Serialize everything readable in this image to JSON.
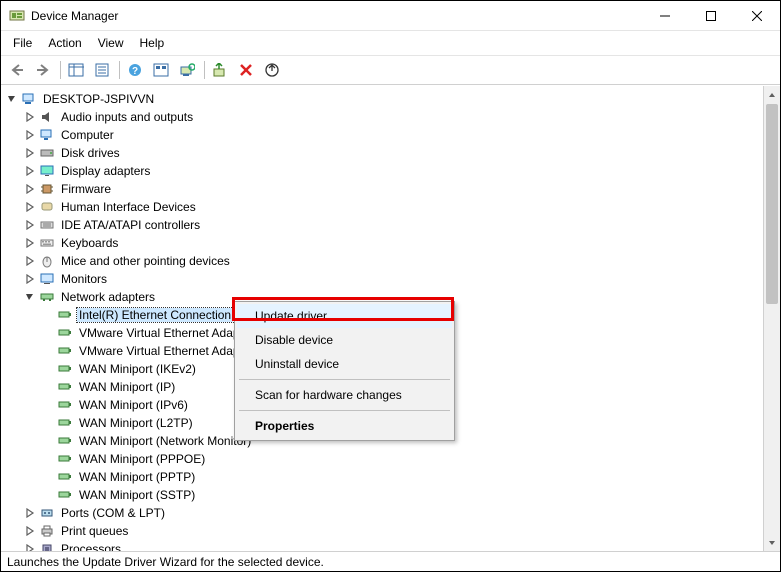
{
  "window": {
    "title": "Device Manager"
  },
  "menu": {
    "file": "File",
    "action": "Action",
    "view": "View",
    "help": "Help"
  },
  "toolbar": {
    "back": "Back",
    "forward": "Forward",
    "show_hide_tree": "Show/Hide Console Tree",
    "properties": "Properties",
    "help": "Help",
    "show_hidden": "Show hidden devices",
    "scan": "Scan for hardware changes",
    "update_driver": "Update device driver",
    "uninstall": "Uninstall device",
    "add_legacy": "Add legacy hardware"
  },
  "root": {
    "label": "DESKTOP-JSPIVVN"
  },
  "categories": [
    {
      "label": "Audio inputs and outputs",
      "icon": "speaker"
    },
    {
      "label": "Computer",
      "icon": "computer"
    },
    {
      "label": "Disk drives",
      "icon": "disk"
    },
    {
      "label": "Display adapters",
      "icon": "display"
    },
    {
      "label": "Firmware",
      "icon": "chip"
    },
    {
      "label": "Human Interface Devices",
      "icon": "hid"
    },
    {
      "label": "IDE ATA/ATAPI controllers",
      "icon": "ide"
    },
    {
      "label": "Keyboards",
      "icon": "keyboard"
    },
    {
      "label": "Mice and other pointing devices",
      "icon": "mouse"
    },
    {
      "label": "Monitors",
      "icon": "monitor"
    }
  ],
  "network": {
    "label": "Network adapters",
    "items": [
      "Intel(R) Ethernet Connection",
      "VMware Virtual Ethernet Adapter",
      "VMware Virtual Ethernet Adapter",
      "WAN Miniport (IKEv2)",
      "WAN Miniport (IP)",
      "WAN Miniport (IPv6)",
      "WAN Miniport (L2TP)",
      "WAN Miniport (Network Monitor)",
      "WAN Miniport (PPPOE)",
      "WAN Miniport (PPTP)",
      "WAN Miniport (SSTP)"
    ]
  },
  "tail_categories": [
    {
      "label": "Ports (COM & LPT)",
      "icon": "port"
    },
    {
      "label": "Print queues",
      "icon": "printer"
    },
    {
      "label": "Processors",
      "icon": "cpu"
    }
  ],
  "context_menu": {
    "update": "Update driver",
    "disable": "Disable device",
    "uninstall": "Uninstall device",
    "scan": "Scan for hardware changes",
    "properties": "Properties"
  },
  "statusbar": {
    "text": "Launches the Update Driver Wizard for the selected device."
  }
}
